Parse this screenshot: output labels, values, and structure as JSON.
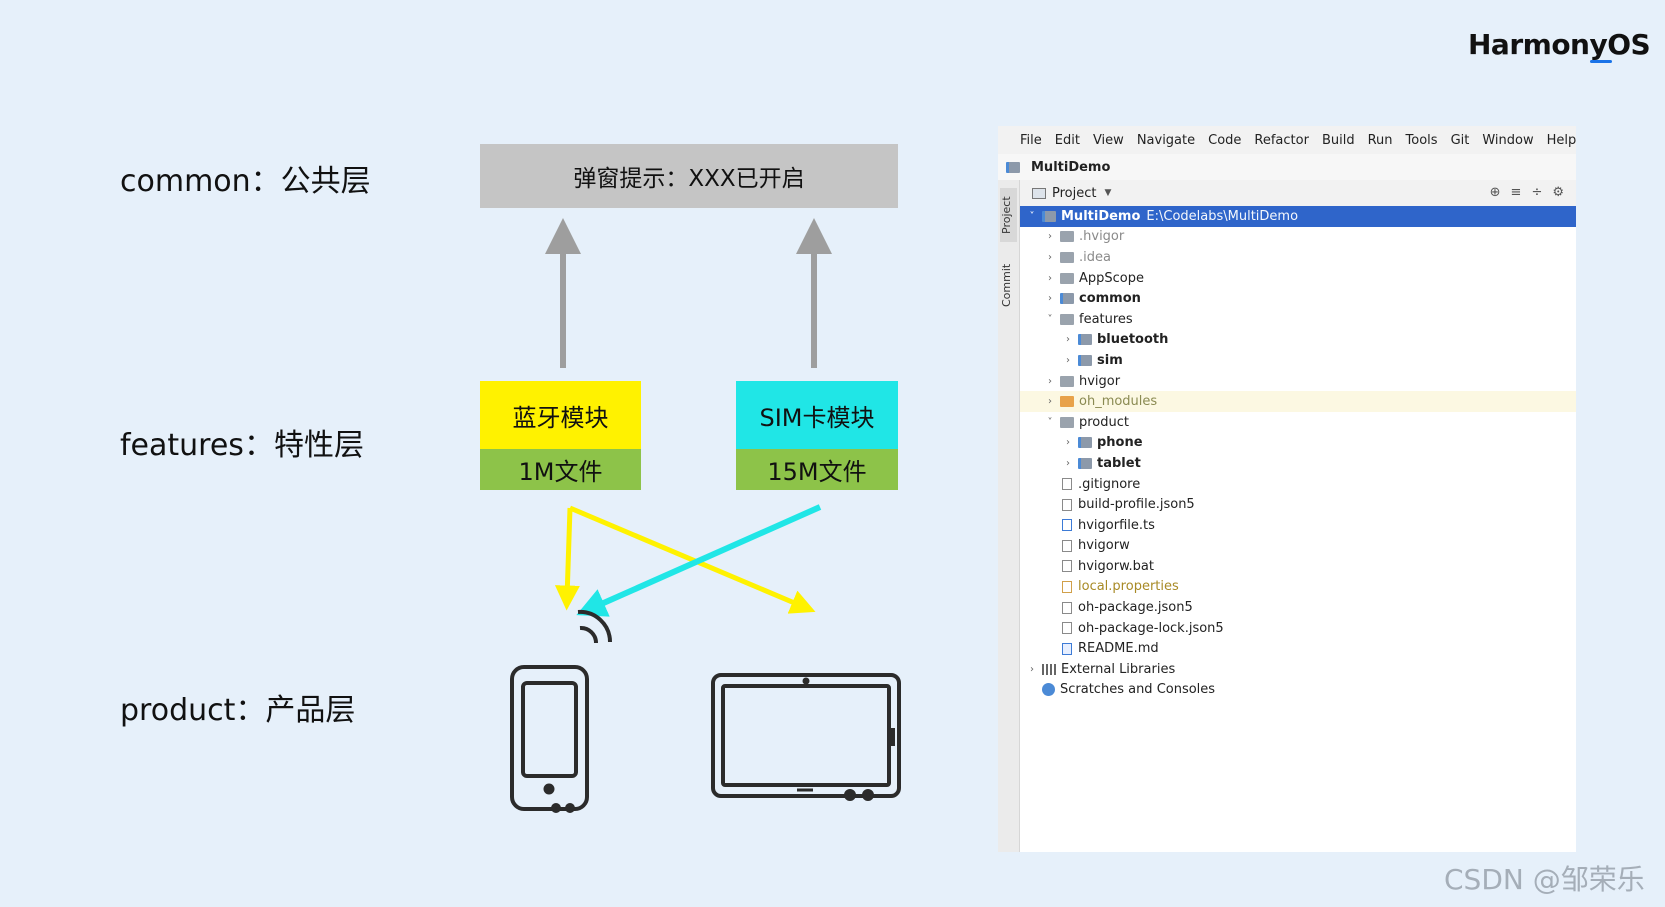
{
  "brand": "HarmonyOS",
  "layers": [
    {
      "label": "common：公共层"
    },
    {
      "label": "features：特性层"
    },
    {
      "label": "product：产品层"
    }
  ],
  "common_box": {
    "label": "弹窗提示：XXX已开启",
    "color": "#c5c5c5"
  },
  "modules": [
    {
      "name": "蓝牙模块",
      "size": "1M文件",
      "color": "#fff200"
    },
    {
      "name": "SIM卡模块",
      "size": "15M文件",
      "color": "#20e6e6"
    }
  ],
  "colors": {
    "file_bar": "#8dc349",
    "up_arrow": "#9e9e9e",
    "bt_line": "#fff200",
    "sim_line": "#20e6e6",
    "device_stroke": "#2b2b2b",
    "selection": "#2f65ca"
  },
  "devices": [
    "phone-icon",
    "tablet-icon"
  ],
  "ide": {
    "menu": [
      "File",
      "Edit",
      "View",
      "Navigate",
      "Code",
      "Refactor",
      "Build",
      "Run",
      "Tools",
      "Git",
      "Window",
      "Help"
    ],
    "nav_title": "MultiDemo",
    "side_tabs": [
      "Project",
      "Commit"
    ],
    "panel_title": "Project",
    "root": {
      "name": "MultiDemo",
      "path": "E:\\Codelabs\\MultiDemo"
    },
    "tree": [
      {
        "label": ".hvigor"
      },
      {
        "label": ".idea"
      },
      {
        "label": "AppScope"
      },
      {
        "label": "common"
      },
      {
        "label": "features"
      },
      {
        "label": "bluetooth"
      },
      {
        "label": "sim"
      },
      {
        "label": "hvigor"
      },
      {
        "label": "oh_modules"
      },
      {
        "label": "product"
      },
      {
        "label": "phone"
      },
      {
        "label": "tablet"
      },
      {
        "label": ".gitignore"
      },
      {
        "label": "build-profile.json5"
      },
      {
        "label": "hvigorfile.ts"
      },
      {
        "label": "hvigorw"
      },
      {
        "label": "hvigorw.bat"
      },
      {
        "label": "local.properties"
      },
      {
        "label": "oh-package.json5"
      },
      {
        "label": "oh-package-lock.json5"
      },
      {
        "label": "README.md"
      },
      {
        "label": "External Libraries"
      },
      {
        "label": "Scratches and Consoles"
      }
    ]
  },
  "watermark": "CSDN @邹荣乐"
}
